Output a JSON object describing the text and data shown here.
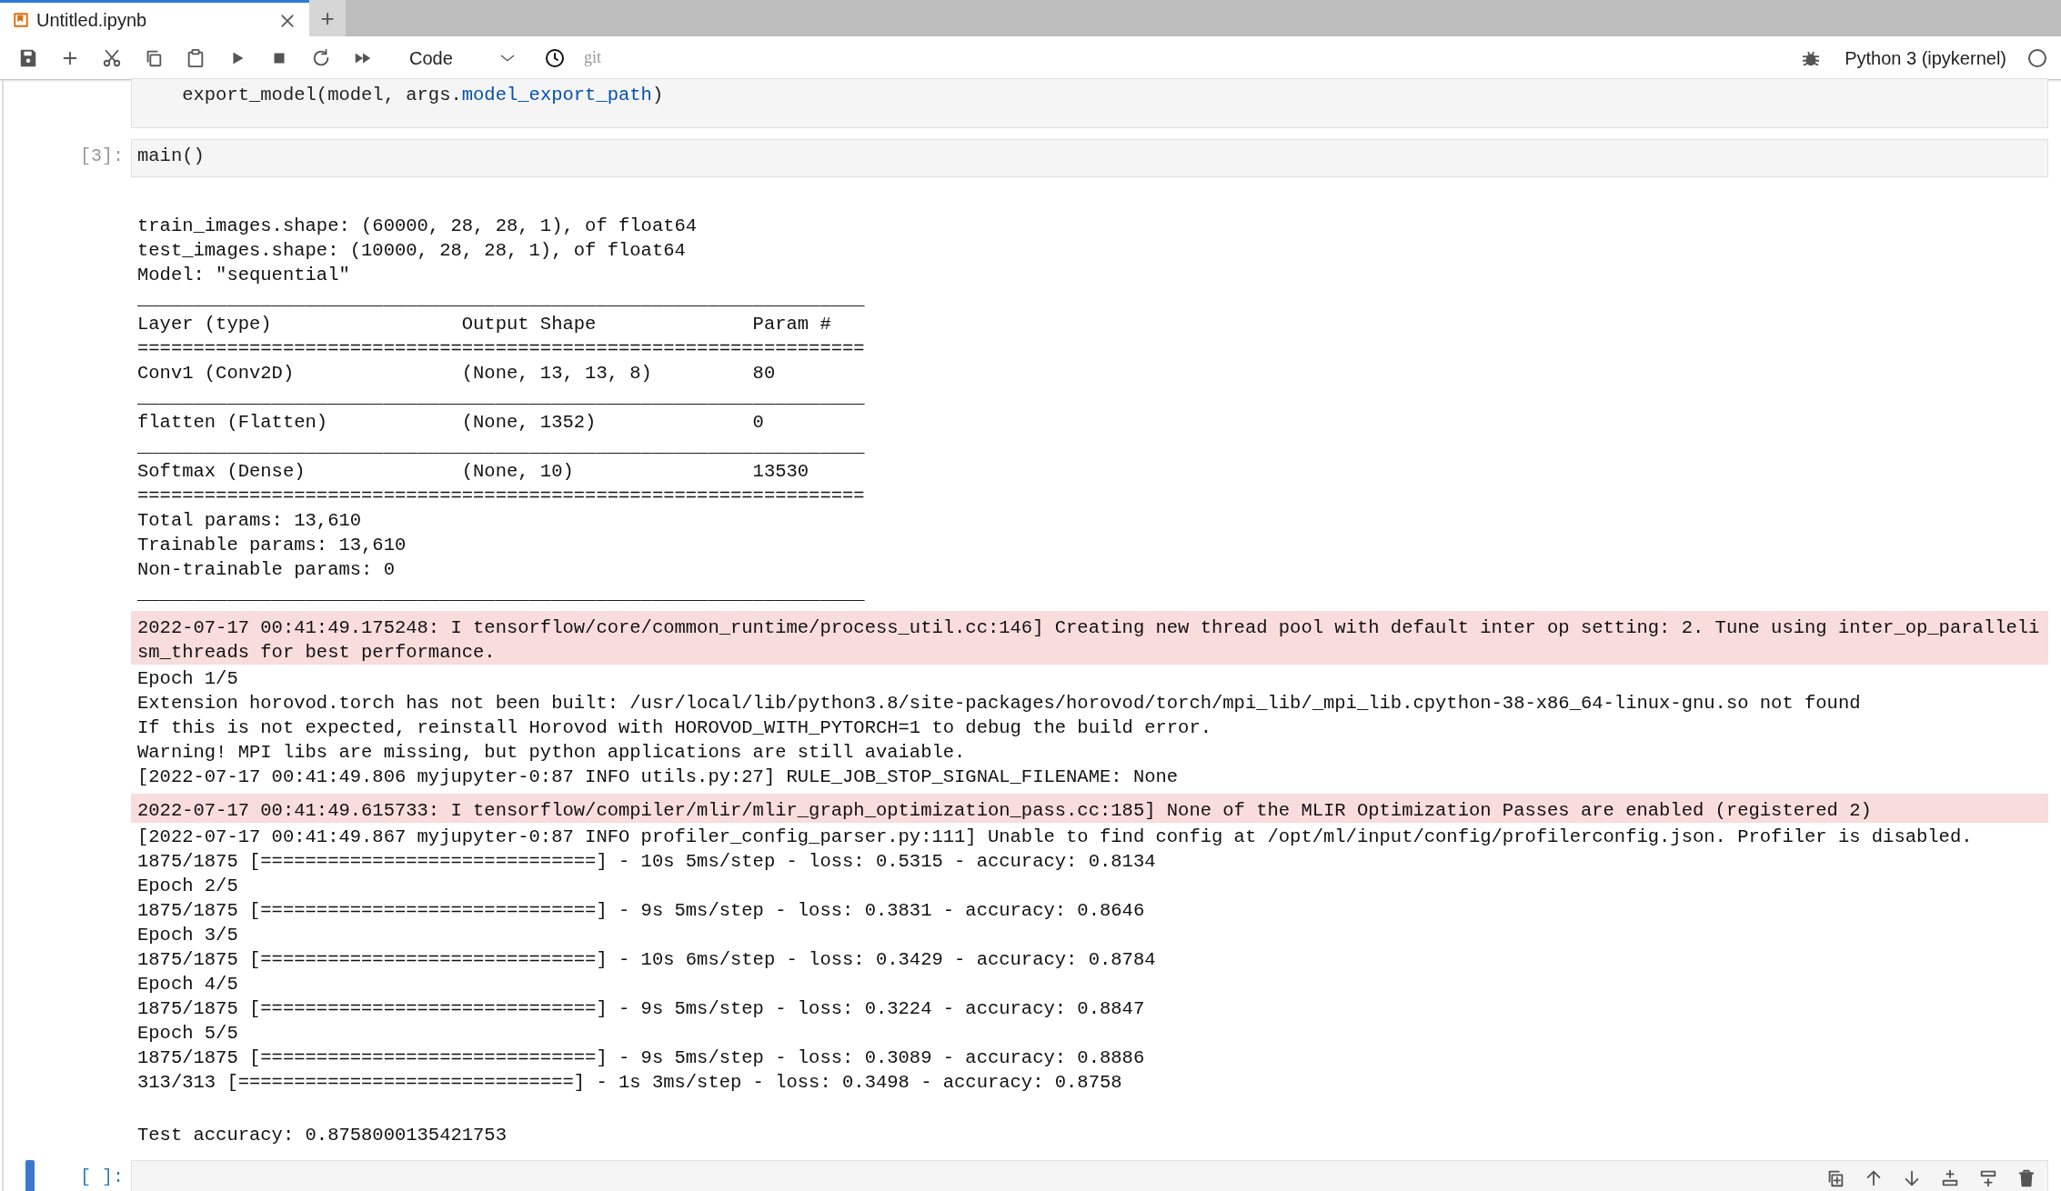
{
  "tabs": [
    {
      "label": "Untitled.ipynb",
      "selected": true
    }
  ],
  "new_tab_label": "+",
  "toolbar": {
    "cell_type": "Code",
    "git_label": "git",
    "kernel_name": "Python 3 (ipykernel)",
    "kernel_busy": false
  },
  "cells": [
    {
      "active": false,
      "code": [
        {
          "kind": "plain",
          "text": "    export_model(model, args."
        },
        {
          "kind": "attribute",
          "text": "model_export_path"
        },
        {
          "kind": "plain",
          "text": ")"
        }
      ]
    },
    {
      "active": false,
      "prompt": "[3]:",
      "code": [
        {
          "kind": "plain",
          "text": "main()"
        }
      ],
      "outputs": [
        {
          "kind": "stdout",
          "lines": [
            "train_images.shape: (60000, 28, 28, 1), of float64",
            "test_images.shape: (10000, 28, 28, 1), of float64",
            "Model: \"sequential\"",
            "_________________________________________________________________",
            "Layer (type)                 Output Shape              Param #",
            "=================================================================",
            "Conv1 (Conv2D)               (None, 13, 13, 8)         80",
            "_________________________________________________________________",
            "flatten (Flatten)            (None, 1352)              0",
            "_________________________________________________________________",
            "Softmax (Dense)              (None, 10)                13530",
            "=================================================================",
            "Total params: 13,610",
            "Trainable params: 13,610",
            "Non-trainable params: 0",
            "_________________________________________________________________"
          ]
        },
        {
          "kind": "stderr",
          "lines": [
            "2022-07-17 00:41:49.175248: I tensorflow/core/common_runtime/process_util.cc:146] Creating new thread pool with default inter op setting: 2. Tune using inter_op_parallelism_threads for best performance."
          ]
        },
        {
          "kind": "stdout",
          "lines": [
            "Epoch 1/5",
            "Extension horovod.torch has not been built: /usr/local/lib/python3.8/site-packages/horovod/torch/mpi_lib/_mpi_lib.cpython-38-x86_64-linux-gnu.so not found",
            "If this is not expected, reinstall Horovod with HOROVOD_WITH_PYTORCH=1 to debug the build error.",
            "Warning! MPI libs are missing, but python applications are still avaiable.",
            "[2022-07-17 00:41:49.806 myjupyter-0:87 INFO utils.py:27] RULE_JOB_STOP_SIGNAL_FILENAME: None"
          ]
        },
        {
          "kind": "stderr",
          "lines": [
            "2022-07-17 00:41:49.615733: I tensorflow/compiler/mlir/mlir_graph_optimization_pass.cc:185] None of the MLIR Optimization Passes are enabled (registered 2)"
          ]
        },
        {
          "kind": "stdout",
          "lines": [
            "[2022-07-17 00:41:49.867 myjupyter-0:87 INFO profiler_config_parser.py:111] Unable to find config at /opt/ml/input/config/profilerconfig.json. Profiler is disabled.",
            "1875/1875 [==============================] - 10s 5ms/step - loss: 0.5315 - accuracy: 0.8134",
            "Epoch 2/5",
            "1875/1875 [==============================] - 9s 5ms/step - loss: 0.3831 - accuracy: 0.8646",
            "Epoch 3/5",
            "1875/1875 [==============================] - 10s 6ms/step - loss: 0.3429 - accuracy: 0.8784",
            "Epoch 4/5",
            "1875/1875 [==============================] - 9s 5ms/step - loss: 0.3224 - accuracy: 0.8847",
            "Epoch 5/5",
            "1875/1875 [==============================] - 9s 5ms/step - loss: 0.3089 - accuracy: 0.8886",
            "313/313 [==============================] - 1s 3ms/step - loss: 0.3498 - accuracy: 0.8758"
          ]
        },
        {
          "kind": "result",
          "lines": [
            "Test accuracy: 0.8758000135421753"
          ]
        }
      ]
    },
    {
      "active": true,
      "prompt": "[ ]:"
    }
  ]
}
